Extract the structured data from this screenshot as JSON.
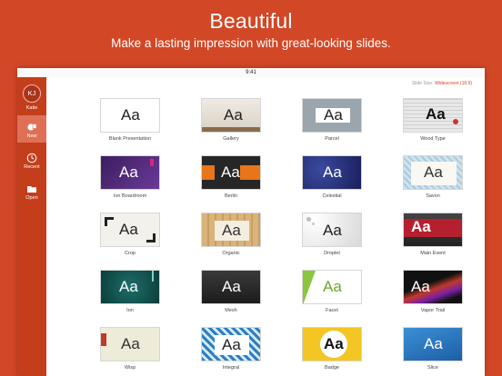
{
  "promo": {
    "title": "Beautiful",
    "subtitle": "Make a lasting impression with great-looking slides."
  },
  "statusbar": {
    "time": "9:41"
  },
  "sidebar": {
    "user": {
      "initials": "KJ",
      "name": "Katie"
    },
    "items": [
      {
        "label": "New",
        "icon": "new-document-icon",
        "active": true
      },
      {
        "label": "Recent",
        "icon": "clock-icon",
        "active": false
      },
      {
        "label": "Open",
        "icon": "folder-icon",
        "active": false
      }
    ]
  },
  "slide_size": {
    "label": "Slide Size",
    "value": "Widescreen (16:9)"
  },
  "themes": [
    {
      "name": "Blank Presentation",
      "sample": "Aa"
    },
    {
      "name": "Gallery",
      "sample": "Aa"
    },
    {
      "name": "Parcel",
      "sample": "Aa"
    },
    {
      "name": "Wood Type",
      "sample": "Aa"
    },
    {
      "name": "Ion Boardroom",
      "sample": "Aa"
    },
    {
      "name": "Berlin",
      "sample": "Aa"
    },
    {
      "name": "Celestial",
      "sample": "Aa"
    },
    {
      "name": "Savon",
      "sample": "Aa"
    },
    {
      "name": "Crop",
      "sample": "Aa"
    },
    {
      "name": "Organic",
      "sample": "Aa"
    },
    {
      "name": "Droplet",
      "sample": "Aa"
    },
    {
      "name": "Main Event",
      "sample": "Aa"
    },
    {
      "name": "Ion",
      "sample": "Aa"
    },
    {
      "name": "Mesh",
      "sample": "Aa"
    },
    {
      "name": "Facet",
      "sample": "Aa"
    },
    {
      "name": "Vapor Trail",
      "sample": "Aa"
    },
    {
      "name": "Wisp",
      "sample": "Aa"
    },
    {
      "name": "Integral",
      "sample": "Aa"
    },
    {
      "name": "Badge",
      "sample": "Aa"
    },
    {
      "name": "Slice",
      "sample": "Aa"
    }
  ],
  "colors": {
    "brand": "#d24726",
    "sidebar": "#c43e1c",
    "active_item": "#e07055"
  }
}
